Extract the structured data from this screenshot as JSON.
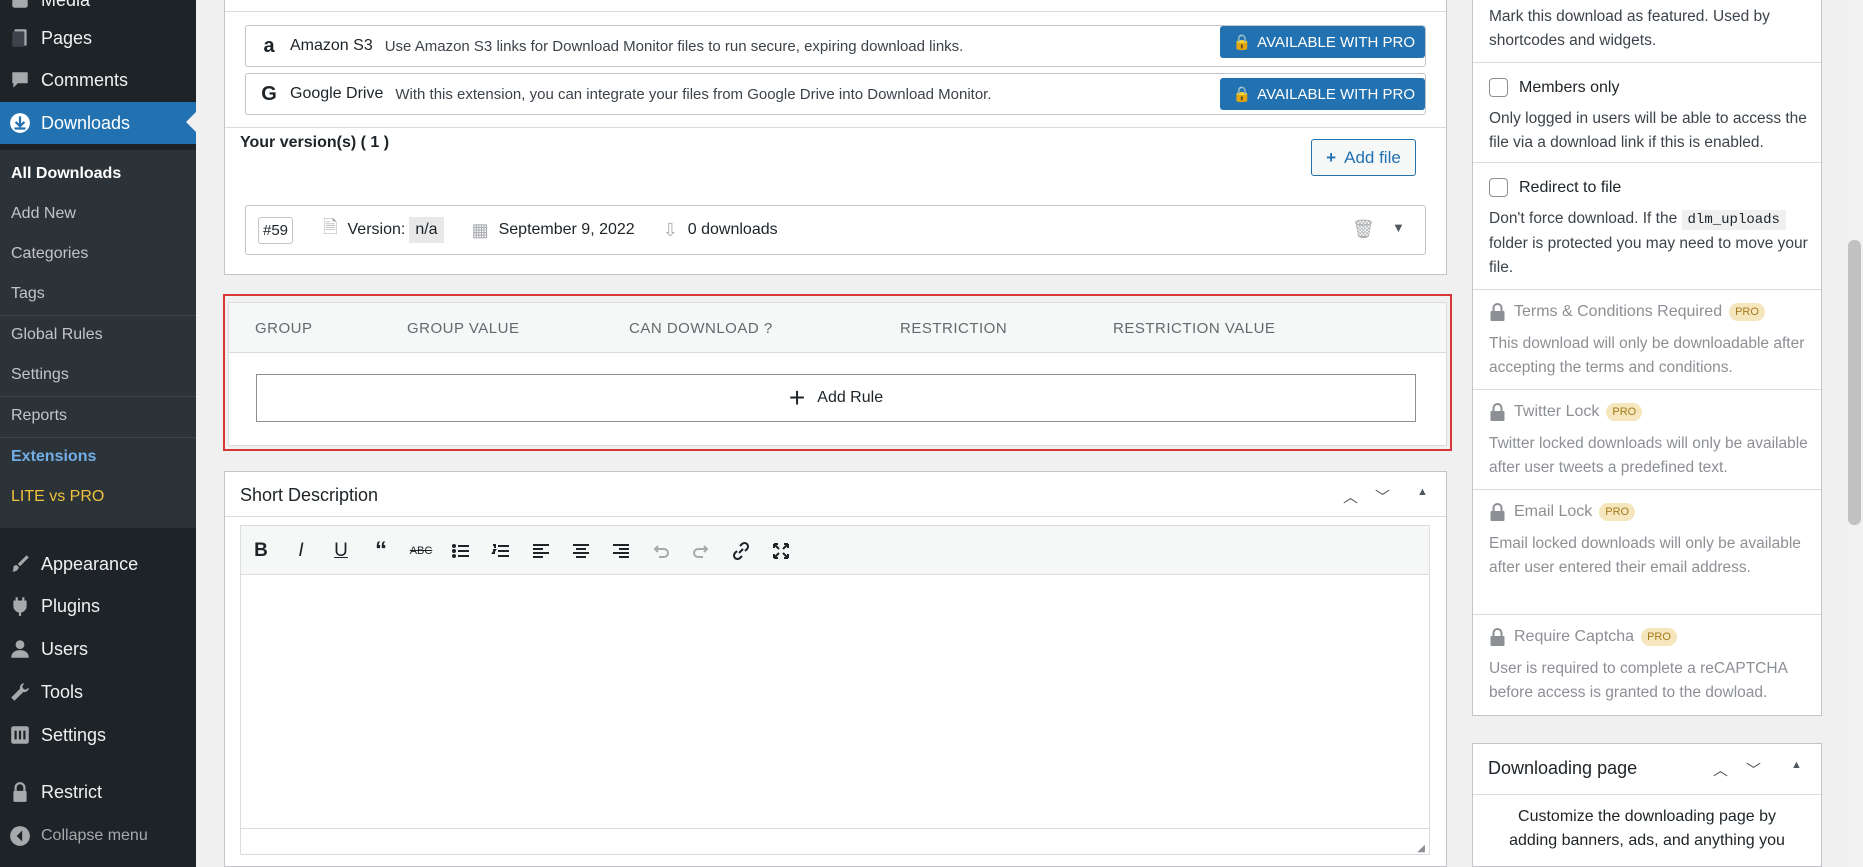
{
  "admin_menu": {
    "items_top": [
      {
        "label": "Media",
        "icon": "media-icon"
      },
      {
        "label": "Pages",
        "icon": "pages-icon"
      },
      {
        "label": "Comments",
        "icon": "comments-icon"
      },
      {
        "label": "Downloads",
        "icon": "download-icon"
      }
    ],
    "submenu": [
      {
        "label": "All Downloads"
      },
      {
        "label": "Add New"
      },
      {
        "label": "Categories"
      },
      {
        "label": "Tags"
      },
      {
        "label": "Global Rules"
      },
      {
        "label": "Settings"
      },
      {
        "label": "Reports"
      },
      {
        "label": "Extensions"
      },
      {
        "label": "LITE vs PRO"
      }
    ],
    "items_bottom": [
      {
        "label": "Appearance",
        "icon": "brush-icon"
      },
      {
        "label": "Plugins",
        "icon": "plug-icon"
      },
      {
        "label": "Users",
        "icon": "user-icon"
      },
      {
        "label": "Tools",
        "icon": "wrench-icon"
      },
      {
        "label": "Settings",
        "icon": "settings-icon"
      },
      {
        "label": "Restrict",
        "icon": "lock-icon"
      },
      {
        "label": "Collapse menu",
        "icon": "collapse-icon"
      }
    ]
  },
  "extensions": [
    {
      "logo": "a",
      "name": "Amazon S3",
      "description": "Use Amazon S3 links for Download Monitor files to run secure, expiring download links.",
      "button": "AVAILABLE WITH PRO"
    },
    {
      "logo": "G",
      "name": "Google Drive",
      "description": "With this extension, you can integrate your files from Google Drive into Download Monitor.",
      "button": "AVAILABLE WITH PRO"
    }
  ],
  "versions": {
    "title": "Your version(s) ( 1 )",
    "add_file": "Add file",
    "row": {
      "id": "#59",
      "version_label": "Version:",
      "version_value": "n/a",
      "date": "September 9, 2022",
      "downloads": "0 downloads"
    }
  },
  "rules": {
    "headers": [
      "GROUP",
      "GROUP VALUE",
      "CAN DOWNLOAD ?",
      "RESTRICTION",
      "RESTRICTION VALUE"
    ],
    "add_rule": "Add Rule"
  },
  "short_description": {
    "title": "Short Description"
  },
  "options": {
    "featured_desc": "Mark this download as featured. Used by shortcodes and widgets.",
    "members_only": {
      "title": "Members only",
      "desc": "Only logged in users will be able to access the file via a download link if this is enabled."
    },
    "redirect": {
      "title": "Redirect to file",
      "desc_before": "Don't force download. If the",
      "code": "dlm_uploads",
      "desc_after": "folder is protected you may need to move your file."
    },
    "terms": {
      "title": "Terms & Conditions Required",
      "badge": "PRO",
      "desc": "This download will only be downloadable after accepting the terms and conditions."
    },
    "twitter": {
      "title": "Twitter Lock",
      "badge": "PRO",
      "desc": "Twitter locked downloads will only be available after user tweets a predefined text."
    },
    "email": {
      "title": "Email Lock",
      "badge": "PRO",
      "desc": "Email locked downloads will only be available after user entered their email address."
    },
    "captcha": {
      "title": "Require Captcha",
      "badge": "PRO",
      "desc": "User is required to complete a reCAPTCHA before access is granted to the dowload."
    }
  },
  "downloading_page": {
    "title": "Downloading page",
    "desc": "Customize the downloading page by adding banners, ads, and anything you"
  },
  "colors": {
    "accent": "#2271b1",
    "highlight": "#d63638",
    "sidebar": "#1d2327"
  }
}
